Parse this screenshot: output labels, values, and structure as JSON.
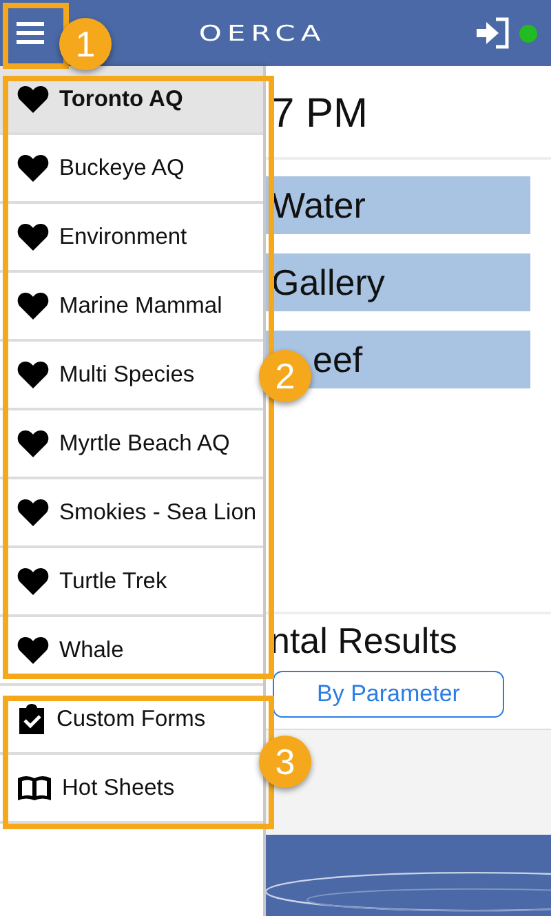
{
  "header": {
    "logo": "OERCA",
    "online": true
  },
  "drawer": {
    "sites": [
      {
        "label": "Toronto AQ",
        "selected": true
      },
      {
        "label": "Buckeye AQ",
        "selected": false
      },
      {
        "label": "Environment",
        "selected": false
      },
      {
        "label": "Marine Mammal",
        "selected": false
      },
      {
        "label": "Multi Species",
        "selected": false
      },
      {
        "label": "Myrtle Beach AQ",
        "selected": false
      },
      {
        "label": "Smokies - Sea Lion",
        "selected": false
      },
      {
        "label": "Turtle Trek",
        "selected": false
      },
      {
        "label": "Whale",
        "selected": false
      }
    ],
    "tools": [
      {
        "label": "Custom Forms",
        "kind": "forms"
      },
      {
        "label": "Hot Sheets",
        "kind": "sheets"
      }
    ]
  },
  "main": {
    "time": "7 PM",
    "sections": [
      "Water",
      "Gallery",
      "eef"
    ],
    "results_title": "ntal Results",
    "parameter_button": "By Parameter"
  },
  "callouts": [
    {
      "number": "1"
    },
    {
      "number": "2"
    },
    {
      "number": "3"
    }
  ]
}
